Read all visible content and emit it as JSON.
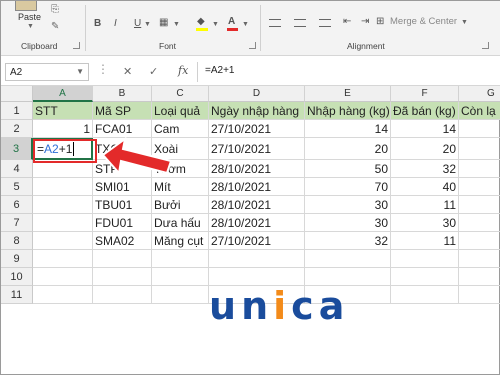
{
  "ribbon": {
    "paste_label": "Paste",
    "clipboard_label": "Clipboard",
    "font_label": "Font",
    "alignment_label": "Alignment",
    "merge_label": "Merge & Center"
  },
  "formula_bar": {
    "name_box": "A2",
    "fx_label": "fx",
    "formula": "=A2+1"
  },
  "columns": [
    "A",
    "B",
    "C",
    "D",
    "E",
    "F",
    "G"
  ],
  "rows": [
    "1",
    "2",
    "3",
    "4",
    "5",
    "6",
    "7",
    "8",
    "9",
    "10",
    "11"
  ],
  "table": {
    "headers": [
      "STT",
      "Mã SP",
      "Loại quả",
      "Ngày nhập hàng",
      "Nhập hàng (kg)",
      "Đã bán (kg)",
      "Còn lạ"
    ],
    "row2": [
      "1",
      "FCA01",
      "Cam",
      "27/10/2021",
      "14",
      "14"
    ],
    "row3": [
      "",
      "TXO",
      "Xoài",
      "27/10/2021",
      "20",
      "20"
    ],
    "row4": [
      "",
      "STP",
      "Thơm",
      "28/10/2021",
      "50",
      "32"
    ],
    "row5": [
      "",
      "SMI01",
      "Mít",
      "28/10/2021",
      "70",
      "40"
    ],
    "row6": [
      "",
      "TBU01",
      "Bưởi",
      "28/10/2021",
      "30",
      "11"
    ],
    "row7": [
      "",
      "FDU01",
      "Dưa hấu",
      "28/10/2021",
      "30",
      "30"
    ],
    "row8": [
      "",
      "SMA02",
      "Măng cụt",
      "27/10/2021",
      "32",
      "11"
    ]
  },
  "editing_cell": {
    "prefix": "=",
    "ref": "A2",
    "suffix": "+1"
  },
  "logo": {
    "letters": [
      "u",
      "n",
      "i",
      "c",
      "a"
    ]
  },
  "colors": {
    "header_fill": "#c6e0b4",
    "excel_green": "#217346",
    "annotation_red": "#e32a2a",
    "logo_blue": "#1a4c9c",
    "logo_orange": "#f38b1a"
  }
}
